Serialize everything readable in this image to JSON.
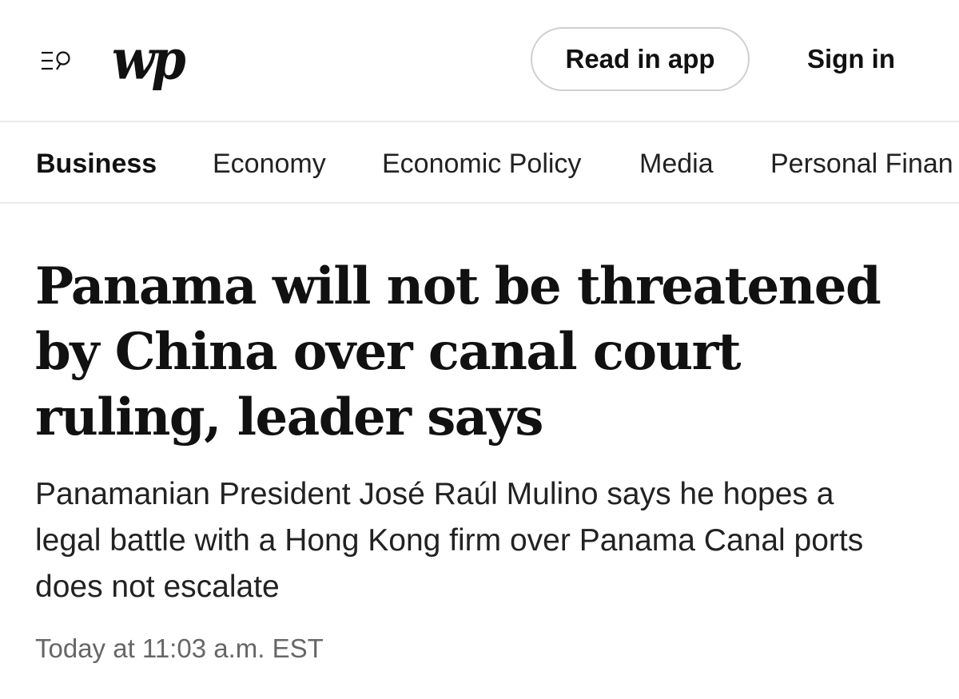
{
  "header": {
    "menu_search_icon": "menu-search-icon",
    "logo_text": "wp",
    "read_in_app_label": "Read in app",
    "sign_in_label": "Sign in"
  },
  "section_nav": {
    "items": [
      {
        "label": "Business",
        "active": true
      },
      {
        "label": "Economy",
        "active": false
      },
      {
        "label": "Economic Policy",
        "active": false
      },
      {
        "label": "Media",
        "active": false
      },
      {
        "label": "Personal Finan",
        "active": false
      }
    ]
  },
  "article": {
    "headline": "Panama will not be threatened by China over canal court ruling, leader says",
    "dek": "Panamanian President José Raúl Mulino says he hopes a legal battle with a Hong Kong firm over Panama Canal ports does not escalate",
    "timestamp": "Today at 11:03 a.m. EST"
  },
  "colors": {
    "text": "#111111",
    "muted": "#666666",
    "border": "#ececec",
    "button_border": "#cfcfcf",
    "background": "#ffffff"
  }
}
